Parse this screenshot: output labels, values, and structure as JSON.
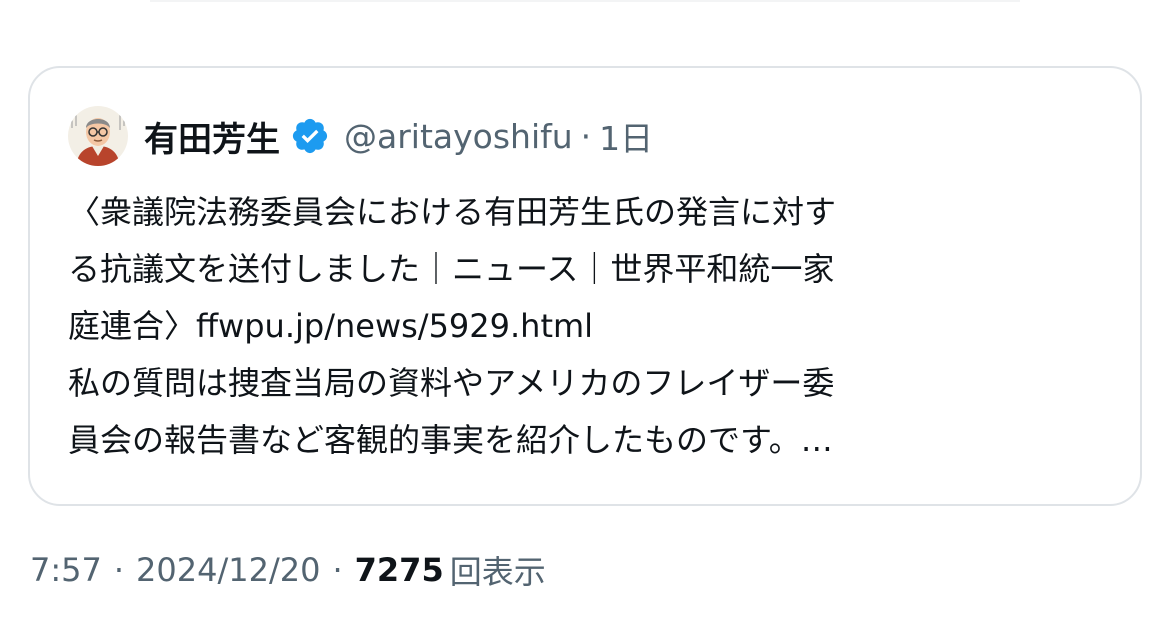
{
  "quoted_tweet": {
    "author": {
      "display_name": "有田芳生",
      "handle": "@aritayoshifu",
      "verified": true,
      "avatar_icon": "illustrated-portrait-avatar"
    },
    "separator": "·",
    "age": "1日",
    "text_lines": [
      "〈衆議院法務委員会における有田芳生氏の発言に対す",
      "る抗議文を送付しました｜ニュース｜世界平和統一家",
      "庭連合〉ffwpu.jp/news/5929.html",
      "私の質問は捜査当局の資料やアメリカのフレイザー委",
      "員会の報告書など客観的事実を紹介したものです。…"
    ]
  },
  "footer": {
    "time": "7:57",
    "separator": "·",
    "date": "2024/12/20",
    "view_count": "7275",
    "view_label": "回表示"
  },
  "colors": {
    "verified_badge": "#1d9bf0",
    "secondary_text": "#536471",
    "primary_text": "#0f1419",
    "card_border": "#dfe3e7"
  }
}
